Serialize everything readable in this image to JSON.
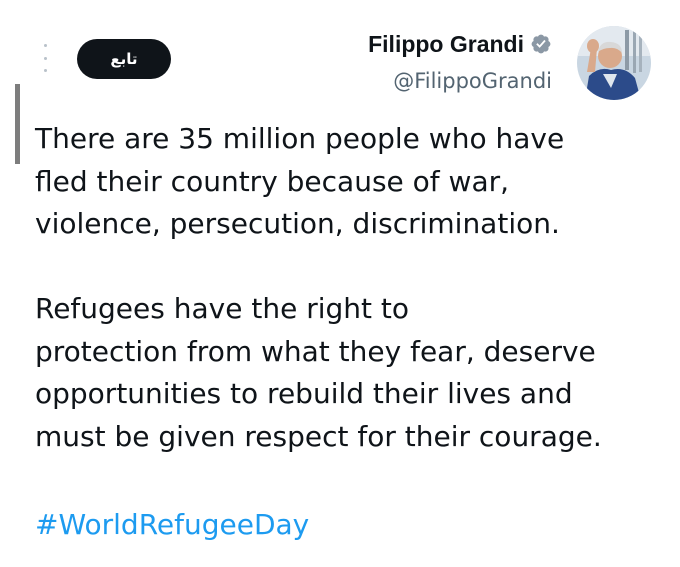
{
  "header": {
    "follow_label": "تابع",
    "display_name": "Filippo Grandi",
    "handle": "@FilippoGrandi",
    "verified_icon": "verified-badge-icon",
    "more_icon": "more-vertical-icon"
  },
  "tweet": {
    "lines_p1": [
      "There are 35 million people who have",
      "fled their country because of war,",
      "violence, persecution, discrimination."
    ],
    "lines_p2": [
      "Refugees have the right to",
      "protection from what they fear, deserve",
      "opportunities to rebuild their lives and",
      "must be given respect for their courage."
    ],
    "hashtag": "#WorldRefugeeDay"
  },
  "colors": {
    "text": "#0f1419",
    "secondary": "#536471",
    "link": "#1d9bf0",
    "verified_badge": "#8b98a5",
    "follow_button_bg": "#0f1419"
  }
}
